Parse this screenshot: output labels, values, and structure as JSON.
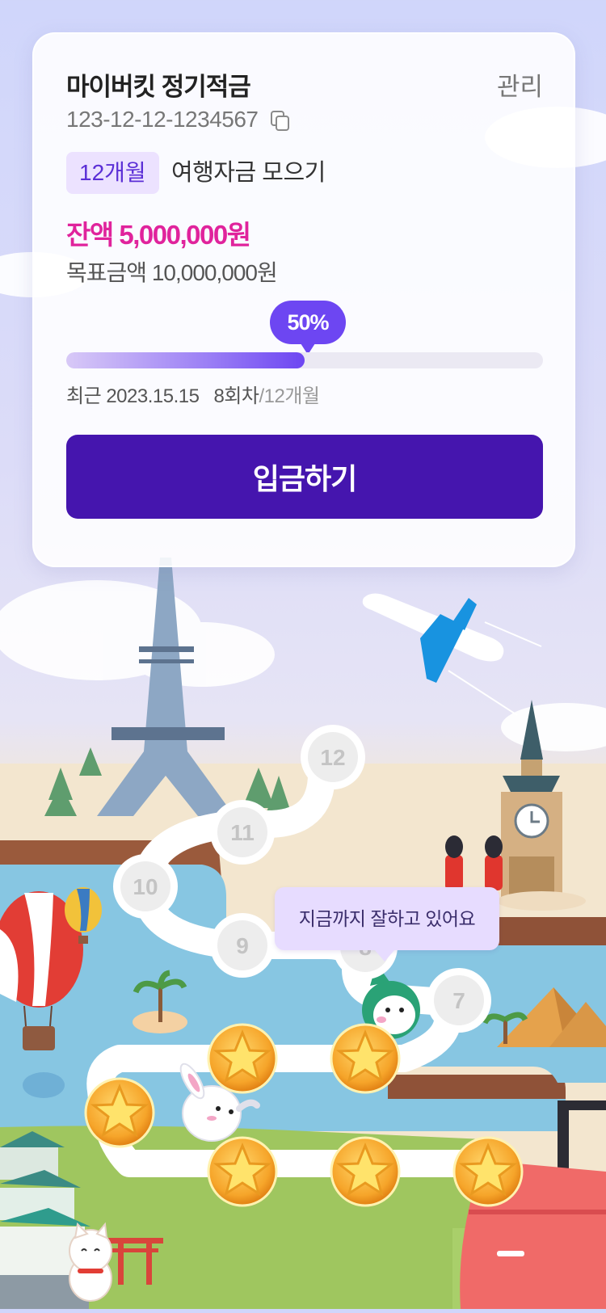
{
  "card": {
    "title": "마이버킷 정기적금",
    "manage_label": "관리",
    "account_number": "123-12-12-1234567",
    "period_tag": "12개월",
    "goal_name": "여행자금 모으기",
    "balance": "잔액 5,000,000원",
    "target": "목표금액 10,000,000원",
    "progress_label": "50%",
    "progress_fraction": 0.5,
    "recent": "최근 2023.15.15",
    "installment_current": "8회차",
    "installment_total": "/12개월",
    "deposit_label": "입금하기"
  },
  "journey": {
    "stages": [
      "7",
      "8",
      "9",
      "10",
      "11",
      "12"
    ],
    "completed_count": 6,
    "tooltip": "지금까지 잘하고 있어요"
  },
  "colors": {
    "accent": "#4515ae",
    "progress": "#6d46f2",
    "balance": "#e0239c",
    "tag_bg": "#ece2ff"
  }
}
